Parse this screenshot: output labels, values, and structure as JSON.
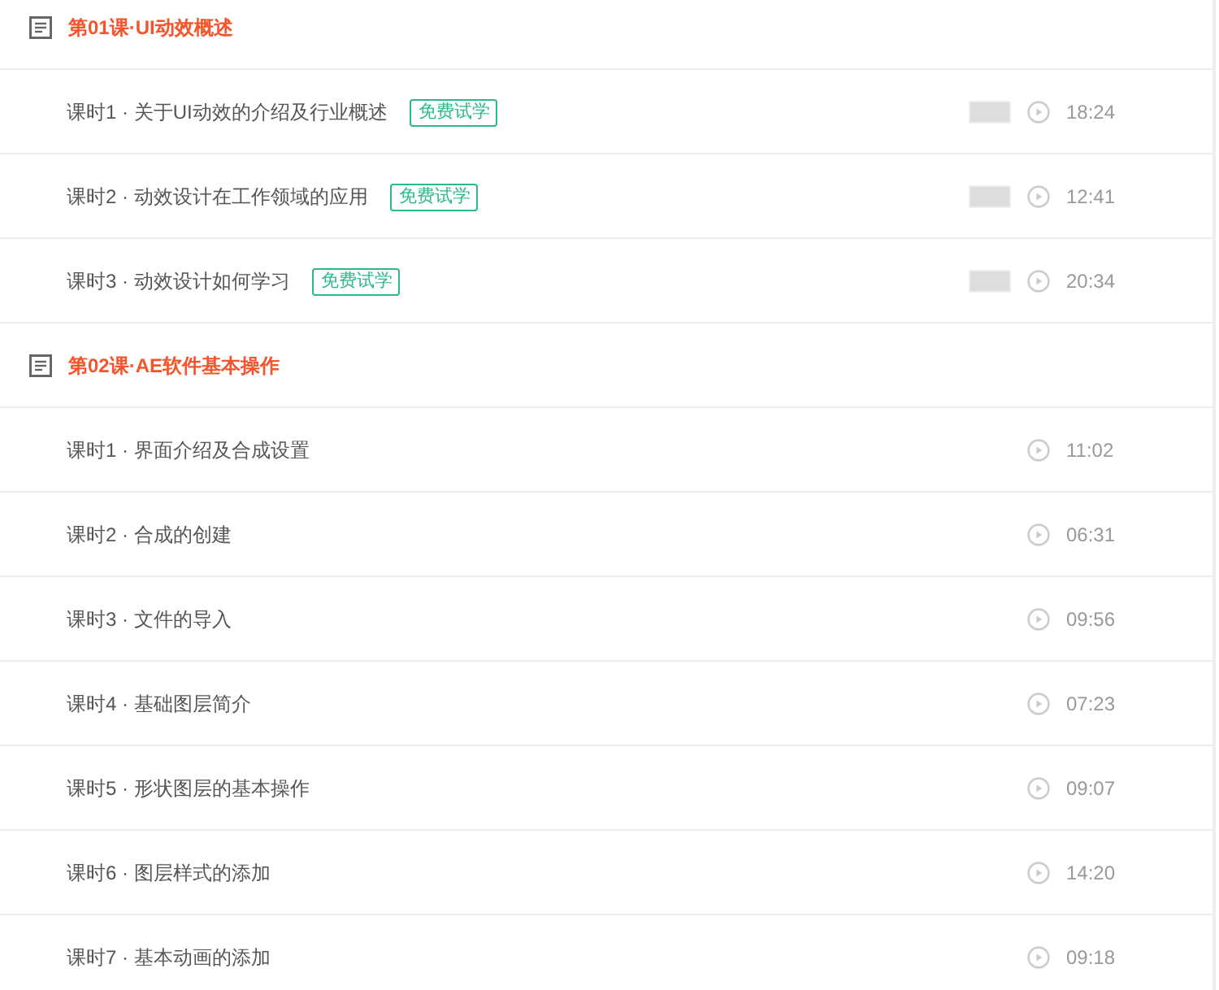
{
  "chapters": [
    {
      "title": "第01课·UI动效概述",
      "lessons": [
        {
          "label": "课时1 · 关于UI动效的介绍及行业概述",
          "badge": "免费试学",
          "preview": true,
          "duration": "18:24"
        },
        {
          "label": "课时2 · 动效设计在工作领域的应用",
          "badge": "免费试学",
          "preview": true,
          "duration": "12:41"
        },
        {
          "label": "课时3 · 动效设计如何学习",
          "badge": "免费试学",
          "preview": true,
          "duration": "20:34"
        }
      ]
    },
    {
      "title": "第02课·AE软件基本操作",
      "lessons": [
        {
          "label": "课时1 · 界面介绍及合成设置",
          "preview": false,
          "duration": "11:02"
        },
        {
          "label": "课时2 · 合成的创建",
          "preview": false,
          "duration": "06:31"
        },
        {
          "label": "课时3 · 文件的导入",
          "preview": false,
          "duration": "09:56"
        },
        {
          "label": "课时4 · 基础图层简介",
          "preview": false,
          "duration": "07:23"
        },
        {
          "label": "课时5 · 形状图层的基本操作",
          "preview": false,
          "duration": "09:07"
        },
        {
          "label": "课时6 · 图层样式的添加",
          "preview": false,
          "duration": "14:20"
        },
        {
          "label": "课时7 · 基本动画的添加",
          "preview": false,
          "duration": "09:18"
        }
      ]
    }
  ]
}
